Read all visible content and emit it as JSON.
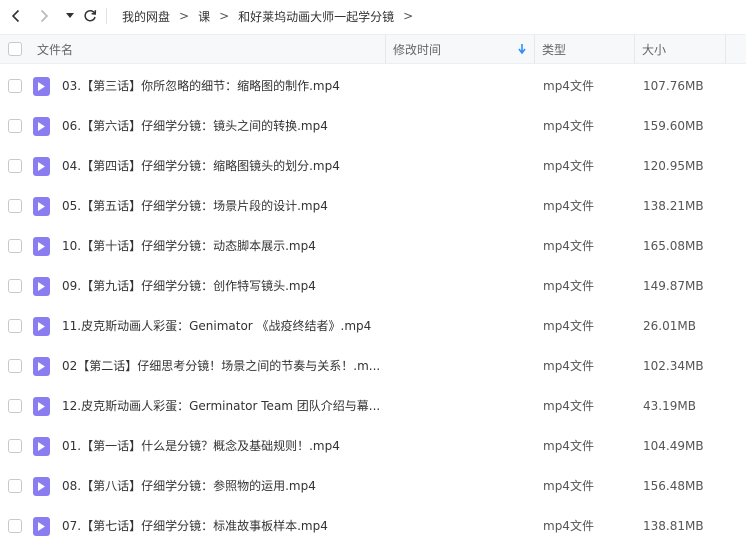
{
  "nav": {
    "breadcrumb": [
      "我的网盘",
      "课",
      "和好莱坞动画大师一起学分镜"
    ],
    "separator": ">"
  },
  "table": {
    "headers": {
      "name": "文件名",
      "modified": "修改时间",
      "type": "类型",
      "size": "大小"
    },
    "sort_indicator": "↓",
    "rows": [
      {
        "name": "03.【第三话】你所忽略的细节：缩略图的制作.mp4",
        "type": "mp4文件",
        "size": "107.76MB"
      },
      {
        "name": "06.【第六话】仔细学分镜：镜头之间的转换.mp4",
        "type": "mp4文件",
        "size": "159.60MB"
      },
      {
        "name": "04.【第四话】仔细学分镜：缩略图镜头的划分.mp4",
        "type": "mp4文件",
        "size": "120.95MB"
      },
      {
        "name": "05.【第五话】仔细学分镜：场景片段的设计.mp4",
        "type": "mp4文件",
        "size": "138.21MB"
      },
      {
        "name": "10.【第十话】仔细学分镜：动态脚本展示.mp4",
        "type": "mp4文件",
        "size": "165.08MB"
      },
      {
        "name": "09.【第九话】仔细学分镜：创作特写镜头.mp4",
        "type": "mp4文件",
        "size": "149.87MB"
      },
      {
        "name": "11.皮克斯动画人彩蛋：Genimator 《战疫终结者》.mp4",
        "type": "mp4文件",
        "size": "26.01MB"
      },
      {
        "name": "02【第二话】仔细思考分镜！场景之间的节奏与关系！.m...",
        "type": "mp4文件",
        "size": "102.34MB"
      },
      {
        "name": "12.皮克斯动画人彩蛋：Germinator Team 团队介绍与幕...",
        "type": "mp4文件",
        "size": "43.19MB"
      },
      {
        "name": "01.【第一话】什么是分镜？概念及基础规则！.mp4",
        "type": "mp4文件",
        "size": "104.49MB"
      },
      {
        "name": "08.【第八话】仔细学分镜：参照物的运用.mp4",
        "type": "mp4文件",
        "size": "156.48MB"
      },
      {
        "name": "07.【第七话】仔细学分镜：标准故事板样本.mp4",
        "type": "mp4文件",
        "size": "138.81MB"
      }
    ]
  },
  "colors": {
    "file_icon": "#8a7df2",
    "sort_arrow": "#2f8cff",
    "header_bg": "#f7f8fa"
  }
}
